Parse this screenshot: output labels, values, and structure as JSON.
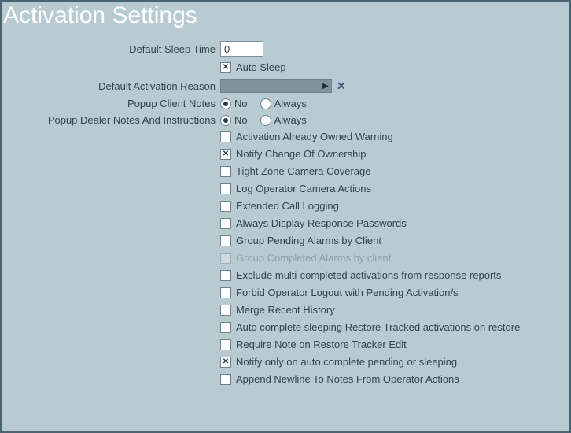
{
  "title": "Activation Settings",
  "fields": {
    "default_sleep_time": {
      "label": "Default Sleep Time",
      "value": "0"
    },
    "auto_sleep": {
      "label": "Auto Sleep",
      "checked": true
    },
    "default_activation_reason": {
      "label": "Default Activation Reason",
      "value": ""
    },
    "popup_client_notes": {
      "label": "Popup Client Notes",
      "options": {
        "no": "No",
        "always": "Always"
      },
      "selected": "no"
    },
    "popup_dealer_notes": {
      "label": "Popup Dealer Notes And Instructions",
      "options": {
        "no": "No",
        "always": "Always"
      },
      "selected": "no"
    }
  },
  "checkboxes": [
    {
      "key": "activation_already_owned_warning",
      "label": "Activation Already Owned Warning",
      "checked": false,
      "disabled": false
    },
    {
      "key": "notify_change_of_ownership",
      "label": "Notify Change Of Ownership",
      "checked": true,
      "disabled": false
    },
    {
      "key": "tight_zone_camera_coverage",
      "label": "Tight Zone Camera Coverage",
      "checked": false,
      "disabled": false
    },
    {
      "key": "log_operator_camera_actions",
      "label": "Log Operator Camera Actions",
      "checked": false,
      "disabled": false
    },
    {
      "key": "extended_call_logging",
      "label": "Extended Call Logging",
      "checked": false,
      "disabled": false
    },
    {
      "key": "always_display_response_passwords",
      "label": "Always Display Response Passwords",
      "checked": false,
      "disabled": false
    },
    {
      "key": "group_pending_alarms_by_client",
      "label": "Group Pending Alarms by Client",
      "checked": false,
      "disabled": false
    },
    {
      "key": "group_completed_alarms_by_client",
      "label": "Group Completed Alarms by client",
      "checked": false,
      "disabled": true
    },
    {
      "key": "exclude_multi_completed_activations",
      "label": "Exclude multi-completed activations from response reports",
      "checked": false,
      "disabled": false
    },
    {
      "key": "forbid_operator_logout_pending",
      "label": "Forbid Operator Logout with Pending Activation/s",
      "checked": false,
      "disabled": false
    },
    {
      "key": "merge_recent_history",
      "label": "Merge Recent History",
      "checked": false,
      "disabled": false
    },
    {
      "key": "auto_complete_sleeping_restore",
      "label": "Auto complete sleeping Restore Tracked activations on restore",
      "checked": false,
      "disabled": false
    },
    {
      "key": "require_note_on_restore_tracker_edit",
      "label": "Require Note on Restore Tracker Edit",
      "checked": false,
      "disabled": false
    },
    {
      "key": "notify_only_on_auto_complete",
      "label": "Notify only on auto complete pending or sleeping",
      "checked": true,
      "disabled": false
    },
    {
      "key": "append_newline_to_notes",
      "label": "Append Newline To Notes From Operator Actions",
      "checked": false,
      "disabled": false
    }
  ]
}
